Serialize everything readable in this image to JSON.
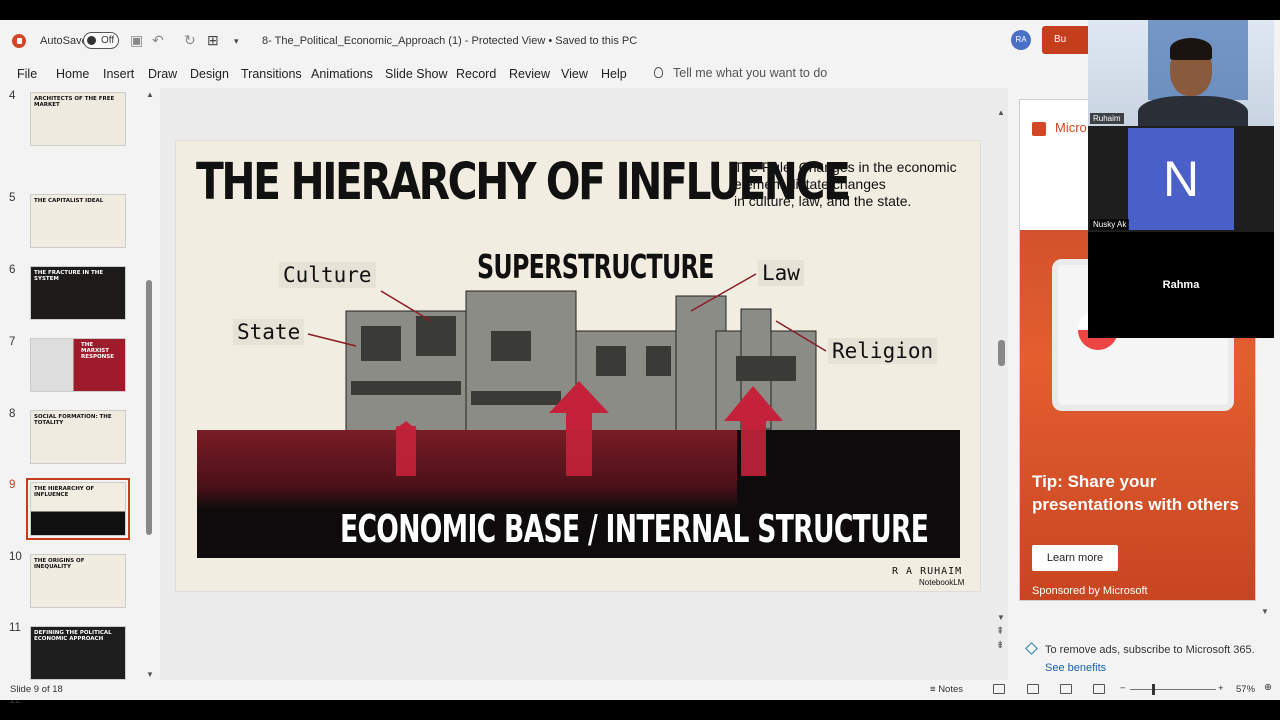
{
  "titlebar": {
    "autosave_label": "AutoSave",
    "autosave_state": "Off",
    "document": "8- The_Political_Economic_Approach (1)  -  Protected View  •  Saved to this PC",
    "avatar_initials": "RA",
    "buy_label": "Bu"
  },
  "ribbon": {
    "tabs": [
      "File",
      "Home",
      "Insert",
      "Draw",
      "Design",
      "Transitions",
      "Animations",
      "Slide Show",
      "Record",
      "Review",
      "View",
      "Help"
    ],
    "tell_me": "Tell me what you want to do"
  },
  "thumbnails": [
    {
      "num": "4",
      "title": "ARCHITECTS OF THE FREE MARKET"
    },
    {
      "num": "5",
      "title": "THE CAPITALIST IDEAL"
    },
    {
      "num": "6",
      "title": "THE FRACTURE IN THE SYSTEM"
    },
    {
      "num": "7",
      "title": "THE MARXIST RESPONSE"
    },
    {
      "num": "8",
      "title": "SOCIAL FORMATION: THE TOTALITY"
    },
    {
      "num": "9",
      "title": "THE HIERARCHY OF INFLUENCE"
    },
    {
      "num": "10",
      "title": "THE ORIGINS OF INEQUALITY"
    },
    {
      "num": "11",
      "title": "DEFINING THE POLITICAL ECONOMIC APPROACH"
    },
    {
      "num": "12",
      "title": ""
    }
  ],
  "slide": {
    "title": "THE HIERARCHY OF INFLUENCE",
    "rule_line1": "The Rule: Changes in the economic",
    "rule_line2": "element dictate changes",
    "rule_line3": "in culture, law, and the state.",
    "superstructure": "SUPERSTRUCTURE",
    "labels": {
      "culture": "Culture",
      "state": "State",
      "law": "Law",
      "religion": "Religion"
    },
    "base": "ECONOMIC BASE / INTERNAL STRUCTURE",
    "author": "R A RUHAIM",
    "notebook": "NotebookLM"
  },
  "ad": {
    "brand": "Micro",
    "tip": "Tip: Share your presentations with others",
    "button": "Learn more",
    "sponsored": "Sponsored by Microsoft",
    "remove": "To remove ads, subscribe to Microsoft 365.",
    "see": "See benefits"
  },
  "video": {
    "p1_name": "Ruhaim",
    "p2_initial": "N",
    "p2_name": "Nusky Ak",
    "p3_name": "Rahma"
  },
  "status": {
    "slide_info": "Slide 9 of 18",
    "notes": "Notes",
    "zoom": "57%"
  }
}
